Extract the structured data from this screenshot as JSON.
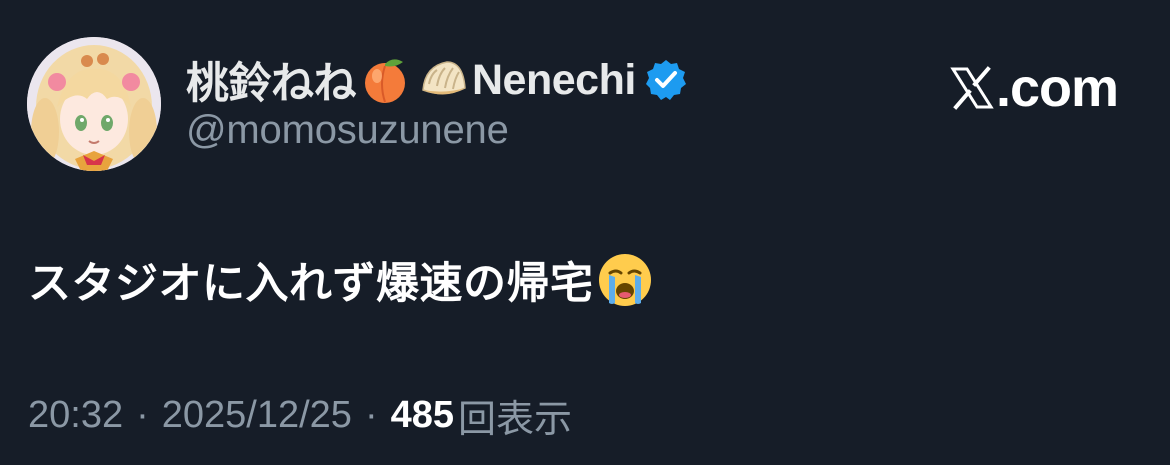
{
  "post": {
    "author": {
      "display_name": "桃鈴ねね",
      "display_name_suffix": "Nenechi",
      "handle": "@momosuzunene",
      "name_emojis": [
        "peach-emoji",
        "dumpling-emoji"
      ],
      "verified": true
    },
    "body_text": "スタジオに入れず爆速の帰宅",
    "body_emoji": "loudly-crying-face-emoji",
    "meta": {
      "time": "20:32",
      "separator": "·",
      "date": "2025/12/25",
      "views_count": "485",
      "views_label": "回表示"
    }
  },
  "site": {
    "logo_text": ".com",
    "logo_mark": "x-logo-icon"
  },
  "colors": {
    "background": "#161d28",
    "primary_text": "#e7e9ea",
    "secondary_text": "#8b98a5",
    "verified_blue": "#1d9bf0"
  }
}
